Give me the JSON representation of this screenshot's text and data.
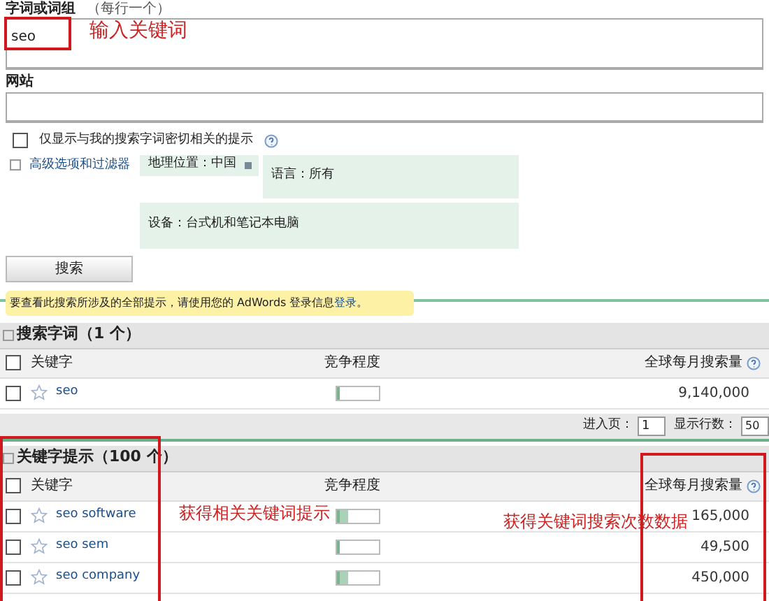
{
  "query_field": {
    "label": "字词或词组",
    "hint": "（每行一个）",
    "value": "seo"
  },
  "website_field": {
    "label": "网站"
  },
  "exact_only": {
    "label": "仅显示与我的搜索字词密切相关的提示",
    "checked": false
  },
  "advanced_link": "高级选项和过滤器",
  "filters": [
    {
      "text": "地理位置：中国"
    },
    {
      "text": "语言：所有"
    },
    {
      "text": "设备：台式机和笔记本电脑"
    }
  ],
  "search_button": "搜索",
  "notice": {
    "text": "要查看此搜索所涉及的全部提示，请使用您的 AdWords 登录信息",
    "link": "登录",
    "end": "。"
  },
  "search_terms": {
    "title": "搜索字词（1 个）",
    "all_checked": false,
    "columns": [
      "关键字",
      "竞争程度",
      "全球每月搜索量"
    ],
    "rows": [
      {
        "keyword": "seo",
        "checked": false,
        "starred": false,
        "level": 0.08,
        "searches": "9,140,000"
      }
    ]
  },
  "pager": {
    "page_label": "进入页：",
    "page": "1",
    "rows_label": "显示行数：",
    "rows": "50"
  },
  "suggestions": {
    "title": "关键字提示（100 个）",
    "all_checked": false,
    "columns": [
      "关键字",
      "竞争程度",
      "全球每月搜索量"
    ],
    "rows": [
      {
        "keyword": "seo software",
        "checked": false,
        "starred": false,
        "level": 0.25,
        "searches": "165,000"
      },
      {
        "keyword": "seo sem",
        "checked": false,
        "starred": false,
        "level": 0.05,
        "searches": "49,500"
      },
      {
        "keyword": "seo company",
        "checked": false,
        "starred": false,
        "level": 0.25,
        "searches": "450,000"
      }
    ]
  },
  "annotations": [
    {
      "text": "输入关键词"
    },
    {
      "text": "获得相关关键词提示"
    },
    {
      "text": "获得关键词搜索次数数据"
    }
  ]
}
